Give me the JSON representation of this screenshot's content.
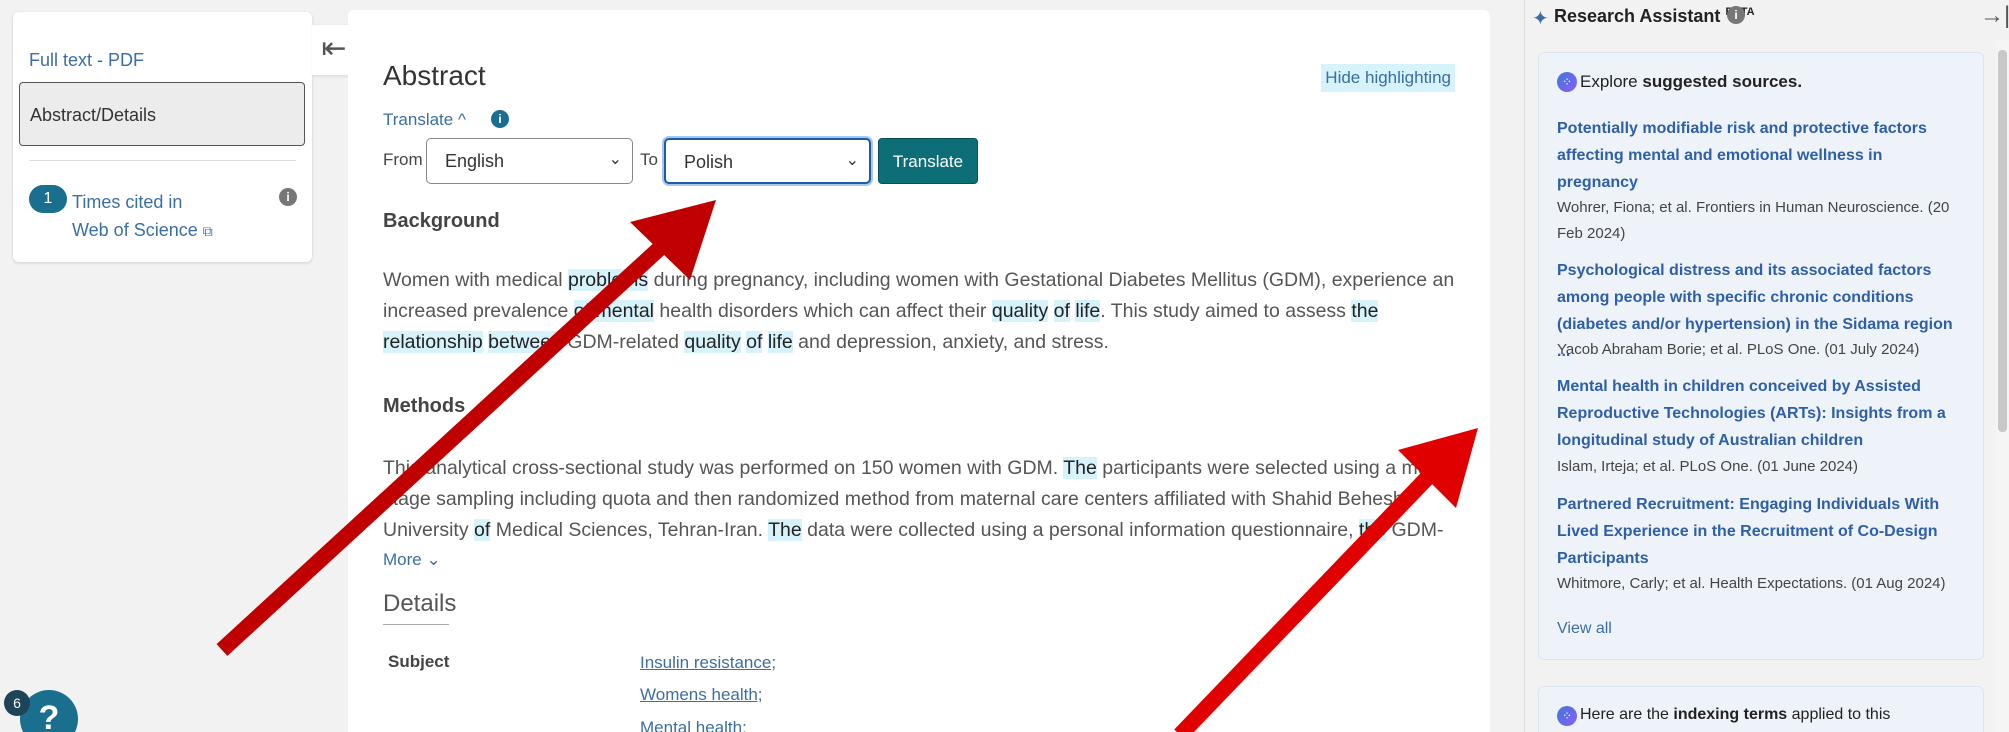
{
  "leftnav": {
    "full_text": "Full text - PDF",
    "abstract_details": "Abstract/Details",
    "cited_count": "1",
    "cited_line1": "Times cited in",
    "cited_line2": "Web of Science",
    "info_glyph": "i"
  },
  "collapse_glyph": "⇤",
  "main": {
    "abstract_title": "Abstract",
    "hide_highlighting": "Hide highlighting",
    "translate_link": "Translate ^",
    "info_glyph": "i",
    "from_label": "From",
    "from_value": "English",
    "to_label": "To",
    "to_value": "Polish",
    "translate_button": "Translate",
    "background_head": "Background",
    "background_text": [
      {
        "t": "Women with medical "
      },
      {
        "t": "problems",
        "h": true
      },
      {
        "t": " during pregnancy, including women with Gestational Diabetes Mellitus (GDM), experience an increased prevalence "
      },
      {
        "t": "of",
        "h": true
      },
      {
        "t": " "
      },
      {
        "t": "mental",
        "h": true
      },
      {
        "t": " health disorders which can affect their "
      },
      {
        "t": "quality",
        "h": true
      },
      {
        "t": " "
      },
      {
        "t": "of",
        "h": true
      },
      {
        "t": " "
      },
      {
        "t": "life",
        "h": true
      },
      {
        "t": ". This study aimed to assess "
      },
      {
        "t": "the",
        "h": true
      },
      {
        "t": " "
      },
      {
        "t": "relationship",
        "h": true
      },
      {
        "t": " "
      },
      {
        "t": "between",
        "h": true
      },
      {
        "t": " GDM-related "
      },
      {
        "t": "quality",
        "h": true
      },
      {
        "t": " "
      },
      {
        "t": "of",
        "h": true
      },
      {
        "t": " "
      },
      {
        "t": "life",
        "h": true
      },
      {
        "t": " and depression, anxiety, and stress."
      }
    ],
    "methods_head": "Methods",
    "methods_text": [
      {
        "t": "This analytical cross-sectional study was performed on 150 women with GDM. "
      },
      {
        "t": "The",
        "h": true
      },
      {
        "t": " participants were selected using a multi-stage sampling including quota and then randomized method from maternal care centers affiliated with Shahid Beheshti University "
      },
      {
        "t": "of",
        "h": true
      },
      {
        "t": " Medical Sciences, Tehran-Iran. "
      },
      {
        "t": "The",
        "h": true
      },
      {
        "t": " data were collected using a personal information questionnaire, "
      },
      {
        "t": "the",
        "h": true
      },
      {
        "t": " GDM-"
      }
    ],
    "more_link": "More ⌄",
    "details_title": "Details",
    "subject_label": "Subject",
    "subjects": [
      "Insulin resistance;",
      "Womens health;",
      "Mental health;"
    ]
  },
  "right_panel": {
    "title": "Research Assistant",
    "beta": "BETA",
    "info_glyph": "i",
    "collapse_glyph": "→|",
    "explore_prefix": "Explore ",
    "explore_bold": "suggested sources.",
    "items": [
      {
        "title": "Potentially modifiable risk and protective factors affecting mental and emotional wellness in pregnancy",
        "meta": "Wohrer, Fiona; et al.  Frontiers in Human Neuroscience. (20 Feb 2024)"
      },
      {
        "title": "Psychological distress and its associated factors among people with specific chronic conditions (diabetes and/or hypertension) in the Sidama region  ...",
        "meta": "Yacob Abraham Borie; et al.  PLoS One. (01 July 2024)"
      },
      {
        "title": "Mental health in children conceived by Assisted Reproductive Technologies (ARTs): Insights from a longitudinal study of Australian children",
        "meta": "Islam, Irteja; et al.  PLoS One. (01 June 2024)"
      },
      {
        "title": "Partnered Recruitment: Engaging Individuals With Lived Experience in the Recruitment of Co-Design Participants",
        "meta": "Whitmore, Carly; et al.  Health Expectations. (01 Aug 2024)"
      }
    ],
    "view_all": "View all",
    "here_prefix": "Here are the ",
    "here_bold": "indexing terms",
    "here_suffix": " applied to this"
  },
  "help": {
    "count": "6",
    "glyph": "?"
  },
  "colors": {
    "accent": "#1a6f8f",
    "link": "#3b6ea5",
    "highlight": "#d6f2fb",
    "arrow": "#c00000"
  }
}
